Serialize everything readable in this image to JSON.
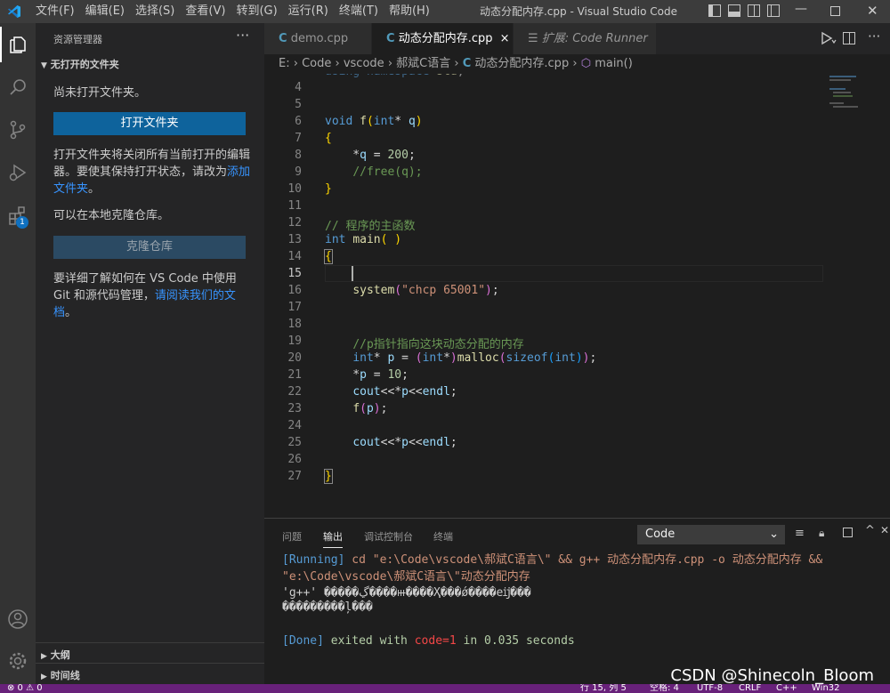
{
  "titlebar": {
    "menus": [
      "文件(F)",
      "编辑(E)",
      "选择(S)",
      "查看(V)",
      "转到(G)",
      "运行(R)",
      "终端(T)",
      "帮助(H)"
    ],
    "title": "动态分配内存.cpp - Visual Studio Code"
  },
  "activity": {
    "extensions_badge": "1"
  },
  "sidebar": {
    "header": "资源管理器",
    "more": "···",
    "section": "无打开的文件夹",
    "no_folder": "尚未打开文件夹。",
    "open_folder_button": "打开文件夹",
    "close_note": "打开文件夹将关闭所有当前打开的编辑器。要使其保持打开状态，请改为",
    "add_folder_link": "添加文件夹",
    "close_note_end": "。",
    "clone_note": "可以在本地克隆仓库。",
    "clone_button": "克隆仓库",
    "learn_note": "要详细了解如何在 VS Code 中使用 Git 和源代码管理，",
    "learn_link": "请阅读我们的文档",
    "learn_end": "。",
    "outline": "大纲",
    "timeline": "时间线"
  },
  "tabs": [
    {
      "label": "demo.cpp"
    },
    {
      "label": "动态分配内存.cpp",
      "close": "×"
    },
    {
      "prefix": "扩展: ",
      "label": "Code Runner"
    }
  ],
  "breadcrumb": [
    "E:",
    "Code",
    "vscode",
    "郝斌C语言",
    "动态分配内存.cpp",
    "main()"
  ],
  "editor": {
    "partial_line": "using namespace std;",
    "line_numbers": [
      "4",
      "5",
      "6",
      "7",
      "8",
      "9",
      "10",
      "11",
      "12",
      "13",
      "14",
      "15",
      "16",
      "17",
      "18",
      "19",
      "20",
      "21",
      "22",
      "23",
      "24",
      "25",
      "26",
      "27"
    ],
    "current_line": "15"
  },
  "panel": {
    "tabs": [
      "问题",
      "输出",
      "调试控制台",
      "终端"
    ],
    "active_tab": "输出",
    "output_select": "Code",
    "running_tag": "[Running]",
    "running_cmd": " cd \"e:\\Code\\vscode\\郝斌C语言\\\" && g++ 动态分配内存.cpp -o 动态分配内存 &&",
    "running_cmd2": "\"e:\\Code\\vscode\\郝斌C语言\\\"动态分配内存",
    "garbled1": "'g++' �����ڲ����ⲿ����Ҳ���ǿ����еĳ���",
    "garbled2": "���������ļ���",
    "done_tag": "[Done]",
    "done_text1": " exited with ",
    "done_code": "code=1",
    "done_text2": " in 0.035 seconds"
  },
  "status": {
    "left": "⊗ 0 ⚠ 0",
    "right": [
      "行 15, 列 5",
      "空格: 4",
      "UTF-8",
      "CRLF",
      "C++",
      "Win32"
    ]
  },
  "watermark": "CSDN @Shinecoln_Bloom"
}
